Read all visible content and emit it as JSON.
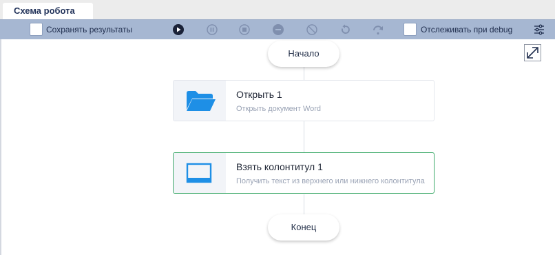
{
  "tabs": [
    {
      "label": "Схема робота"
    }
  ],
  "toolbar": {
    "save_results_label": "Сохранять результаты",
    "track_debug_label": "Отслеживать при debug"
  },
  "flow": {
    "start_label": "Начало",
    "end_label": "Конец",
    "steps": [
      {
        "title": "Открыть  1",
        "subtitle": "Открыть документ Word",
        "icon": "folder-icon"
      },
      {
        "title": "Взять колонтитул  1",
        "subtitle": "Получить текст из верхнего или нижнего колонтитула",
        "icon": "monitor-icon"
      }
    ]
  },
  "colors": {
    "toolbar_bg": "#a6b7d2",
    "accent_blue": "#1e8fe6",
    "selected_border": "#3aa867"
  }
}
